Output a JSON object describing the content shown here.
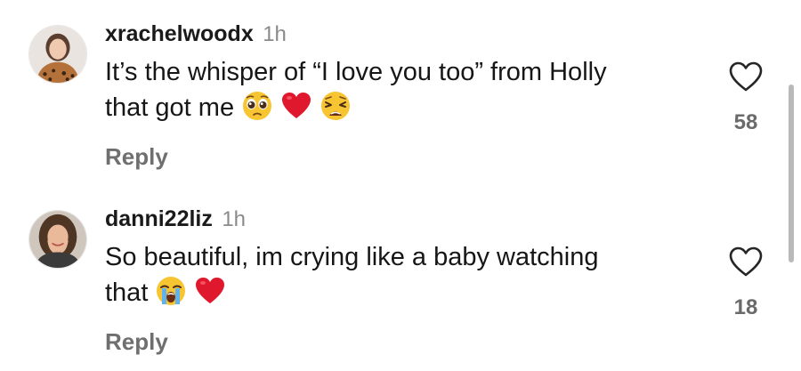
{
  "comments": [
    {
      "username": "xrachelwoodx",
      "time": "1h",
      "text_line1": "It’s the whisper of “I love you too” from Holly",
      "text_line2": "that got me",
      "emojis": [
        "pleading-face",
        "red-heart",
        "weary-face"
      ],
      "reply_label": "Reply",
      "like_count": "58"
    },
    {
      "username": "danni22liz",
      "time": "1h",
      "text_line1": "So beautiful, im crying like a baby watching",
      "text_line2": "that",
      "emojis": [
        "loudly-crying-face",
        "red-heart"
      ],
      "reply_label": "Reply",
      "like_count": "18"
    }
  ],
  "colors": {
    "username": "#1a1a1a",
    "muted": "#8a8a8a",
    "reply": "#6f6f6f",
    "heart_outline": "#262626",
    "emoji_heart": "#e0182d",
    "emoji_face": "#f7c531"
  }
}
